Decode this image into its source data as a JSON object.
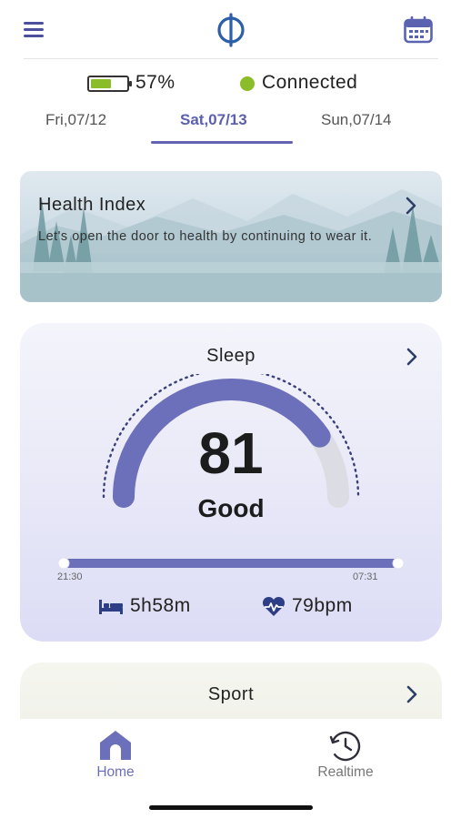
{
  "header": {
    "menu_icon": "hamburger-menu-icon",
    "logo_icon": "phi-logo-icon",
    "calendar_icon": "calendar-icon"
  },
  "status": {
    "battery_percent": 57,
    "battery_label": "57%",
    "battery_color": "#8bbd2a",
    "connection_label": "Connected",
    "connection_color": "#8bbd2a"
  },
  "date_tabs": [
    {
      "label": "Fri,07/12",
      "active": false
    },
    {
      "label": "Sat,07/13",
      "active": true
    },
    {
      "label": "Sun,07/14",
      "active": false
    }
  ],
  "health_index": {
    "title": "Health Index",
    "description": "Let's open the door to health by continuing to wear it."
  },
  "sleep": {
    "title": "Sleep",
    "score": "81",
    "score_value": 81,
    "score_max": 100,
    "quality": "Good",
    "start_time": "21:30",
    "end_time": "07:31",
    "duration": "5h58m",
    "heart_rate": "79bpm",
    "accent_color": "#6c6fb9"
  },
  "sport": {
    "title": "Sport"
  },
  "bottom_nav": {
    "home_label": "Home",
    "realtime_label": "Realtime",
    "active_color": "#6c6fb9",
    "inactive_color": "#777777"
  }
}
